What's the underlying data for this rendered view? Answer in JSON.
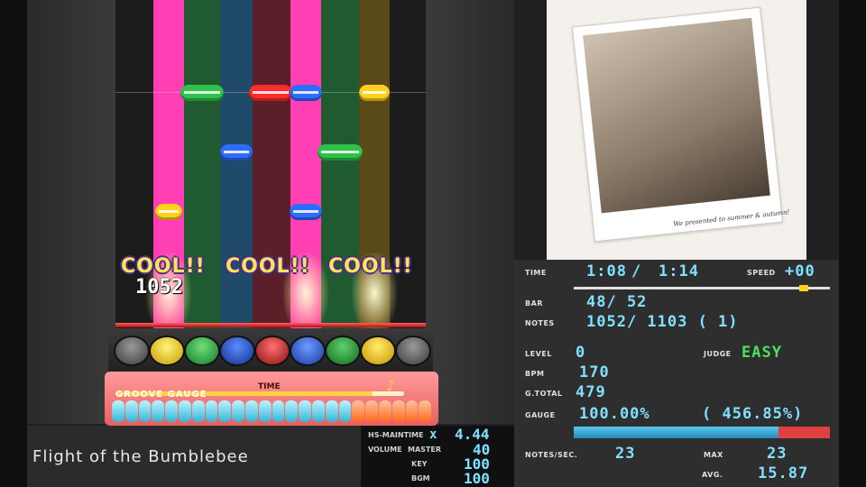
{
  "song": {
    "title": "Flight of the Bumblebee"
  },
  "playfield": {
    "judgements": [
      "COOL!!",
      "COOL!!",
      "COOL!!"
    ],
    "combo": "1052"
  },
  "gauge_panel": {
    "time_label": "TIME",
    "groove_label": "GROOVE GAUGE",
    "time_progress": 0.89,
    "groove_filled_cells": 24,
    "groove_total_cells": 24
  },
  "mini_status": {
    "hs_label": "HS-MAINTIME",
    "hs_mult": "x",
    "hs_value": "4.44",
    "volume_label": "VOLUME",
    "master_label": "MASTER",
    "master_value": "40",
    "key_label": "KEY",
    "key_value": "100",
    "bgm_label": "BGM",
    "bgm_value": "100"
  },
  "jacket": {
    "caption": "We presented to summer & autumn!"
  },
  "stats": {
    "time_label": "TIME",
    "time_current": "1:08",
    "time_total": "1:14",
    "speed_label": "SPEED",
    "speed_value": "+00",
    "bar_label": "BAR",
    "bar_value": "48/ 52",
    "notes_label": "NOTES",
    "notes_value": "1052/ 1103 ( 1)",
    "level_label": "LEVEL",
    "level_value": "0",
    "judge_label": "JUDGE",
    "judge_value": "EASY",
    "bpm_label": "BPM",
    "bpm_value": "170",
    "gtotal_label": "G.TOTAL",
    "gtotal_value": "479",
    "gauge_label": "GAUGE",
    "gauge_value": "100.00%",
    "gauge_extra": "( 456.85%)",
    "gauge_fill_fraction": 0.8,
    "notes_sec_label": "NOTES/SEC.",
    "notes_sec_value": "23",
    "max_label": "MAX",
    "max_value": "23",
    "avg_label": "AVG.",
    "avg_value": "15.87"
  },
  "colors": {
    "lane_pink": "#ff3fb3",
    "lane_green": "#1f7a3a",
    "lane_blue": "#1f4a6a",
    "lane_red": "#7a1f2a",
    "note_yellow": "#ffd21a",
    "note_green": "#2fc24a",
    "note_blue": "#2e6bff",
    "note_red": "#ff2a2a",
    "accent_cyan": "#7fe0ff",
    "judge_green": "#4ce060"
  }
}
